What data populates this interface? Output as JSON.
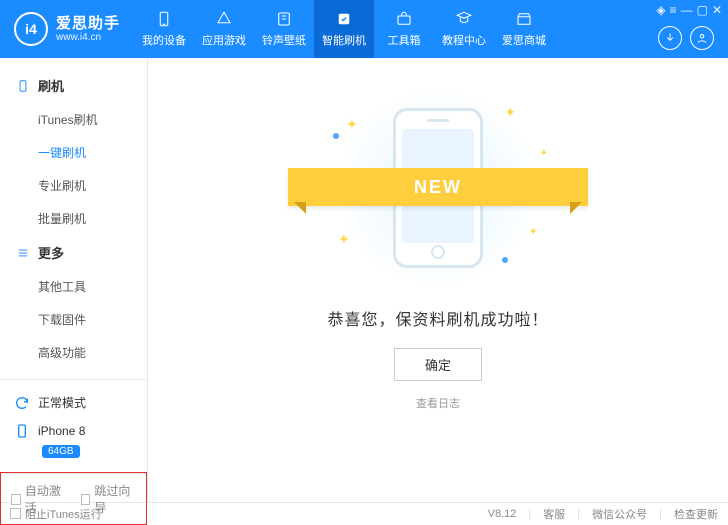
{
  "logo": {
    "badge": "i4",
    "title": "爱思助手",
    "url": "www.i4.cn"
  },
  "nav": [
    {
      "label": "我的设备",
      "icon": "device"
    },
    {
      "label": "应用游戏",
      "icon": "apps"
    },
    {
      "label": "铃声壁纸",
      "icon": "music"
    },
    {
      "label": "智能刷机",
      "icon": "flash",
      "active": true
    },
    {
      "label": "工具箱",
      "icon": "toolbox"
    },
    {
      "label": "教程中心",
      "icon": "tutorial"
    },
    {
      "label": "爱思商城",
      "icon": "store"
    }
  ],
  "sidebar": {
    "group1": {
      "head": "刷机",
      "items": [
        "iTunes刷机",
        "一键刷机",
        "专业刷机",
        "批量刷机"
      ],
      "activeIndex": 1
    },
    "group2": {
      "head": "更多",
      "items": [
        "其他工具",
        "下载固件",
        "高级功能"
      ]
    }
  },
  "status": {
    "mode": "正常模式",
    "device": "iPhone 8",
    "storage": "64GB"
  },
  "bottomChecks": {
    "auto": "自动激活",
    "skip": "跳过向导"
  },
  "main": {
    "ribbon": "NEW",
    "success": "恭喜您，保资料刷机成功啦！",
    "ok": "确定",
    "viewLog": "查看日志"
  },
  "footer": {
    "blockItunes": "阻止iTunes运行",
    "version": "V8.12",
    "support": "客服",
    "wechat": "微信公众号",
    "update": "检查更新"
  }
}
